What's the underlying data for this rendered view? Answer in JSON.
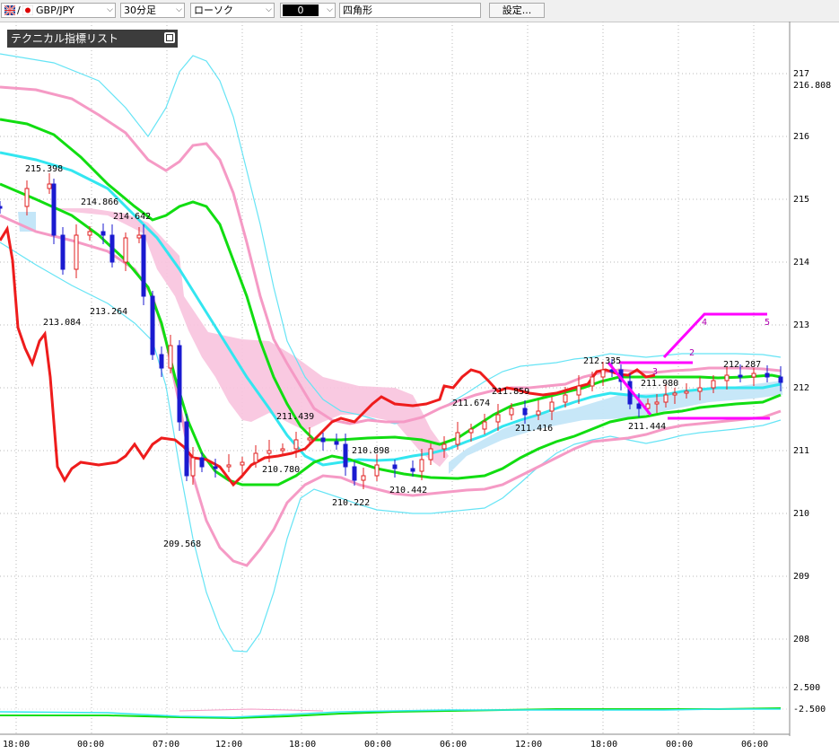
{
  "toolbar": {
    "symbol": "GBP/JPY",
    "symbol_prefix": "/",
    "timeframe": "30分足",
    "chart_style": "ローソク",
    "color_value": "0",
    "drawing_tool": "四角形",
    "settings_label": "設定..."
  },
  "indicator_panel": {
    "title": "テクニカル指標リスト"
  },
  "price_axis": {
    "ticks": [
      "217",
      "216",
      "215",
      "214",
      "213",
      "212",
      "211",
      "210",
      "209",
      "208"
    ],
    "current_price_label": "216.808",
    "osc_upper": "2.500",
    "osc_lower": "-2.500"
  },
  "time_axis": {
    "labels": [
      "18:00",
      "00:00",
      "07:00",
      "12:00",
      "18:00",
      "00:00",
      "06:00",
      "12:00",
      "18:00",
      "00:00",
      "06:00"
    ]
  },
  "annotations": {
    "high_low_labels": [
      "215.398",
      "214.866",
      "214.642",
      "213.084",
      "213.264",
      "209.568",
      "211.439",
      "210.780",
      "210.898",
      "210.222",
      "210.442",
      "211.674",
      "211.859",
      "211.416",
      "212.335",
      "211.980",
      "211.444",
      "212.287"
    ],
    "wave_labels": [
      "2",
      "3",
      "4",
      "5"
    ]
  },
  "colors": {
    "accent_magenta": "#ff00ff",
    "ma_red": "#ee1c1c",
    "ma_green": "#00dd00",
    "ma_cyan": "#33e6f0",
    "band_pink": "#f59ac5",
    "cloud_pink": "#f8bcdc",
    "cloud_blue": "#bfe4f7",
    "candle_up": "#e02020",
    "candle_down": "#1a1ad0"
  }
}
